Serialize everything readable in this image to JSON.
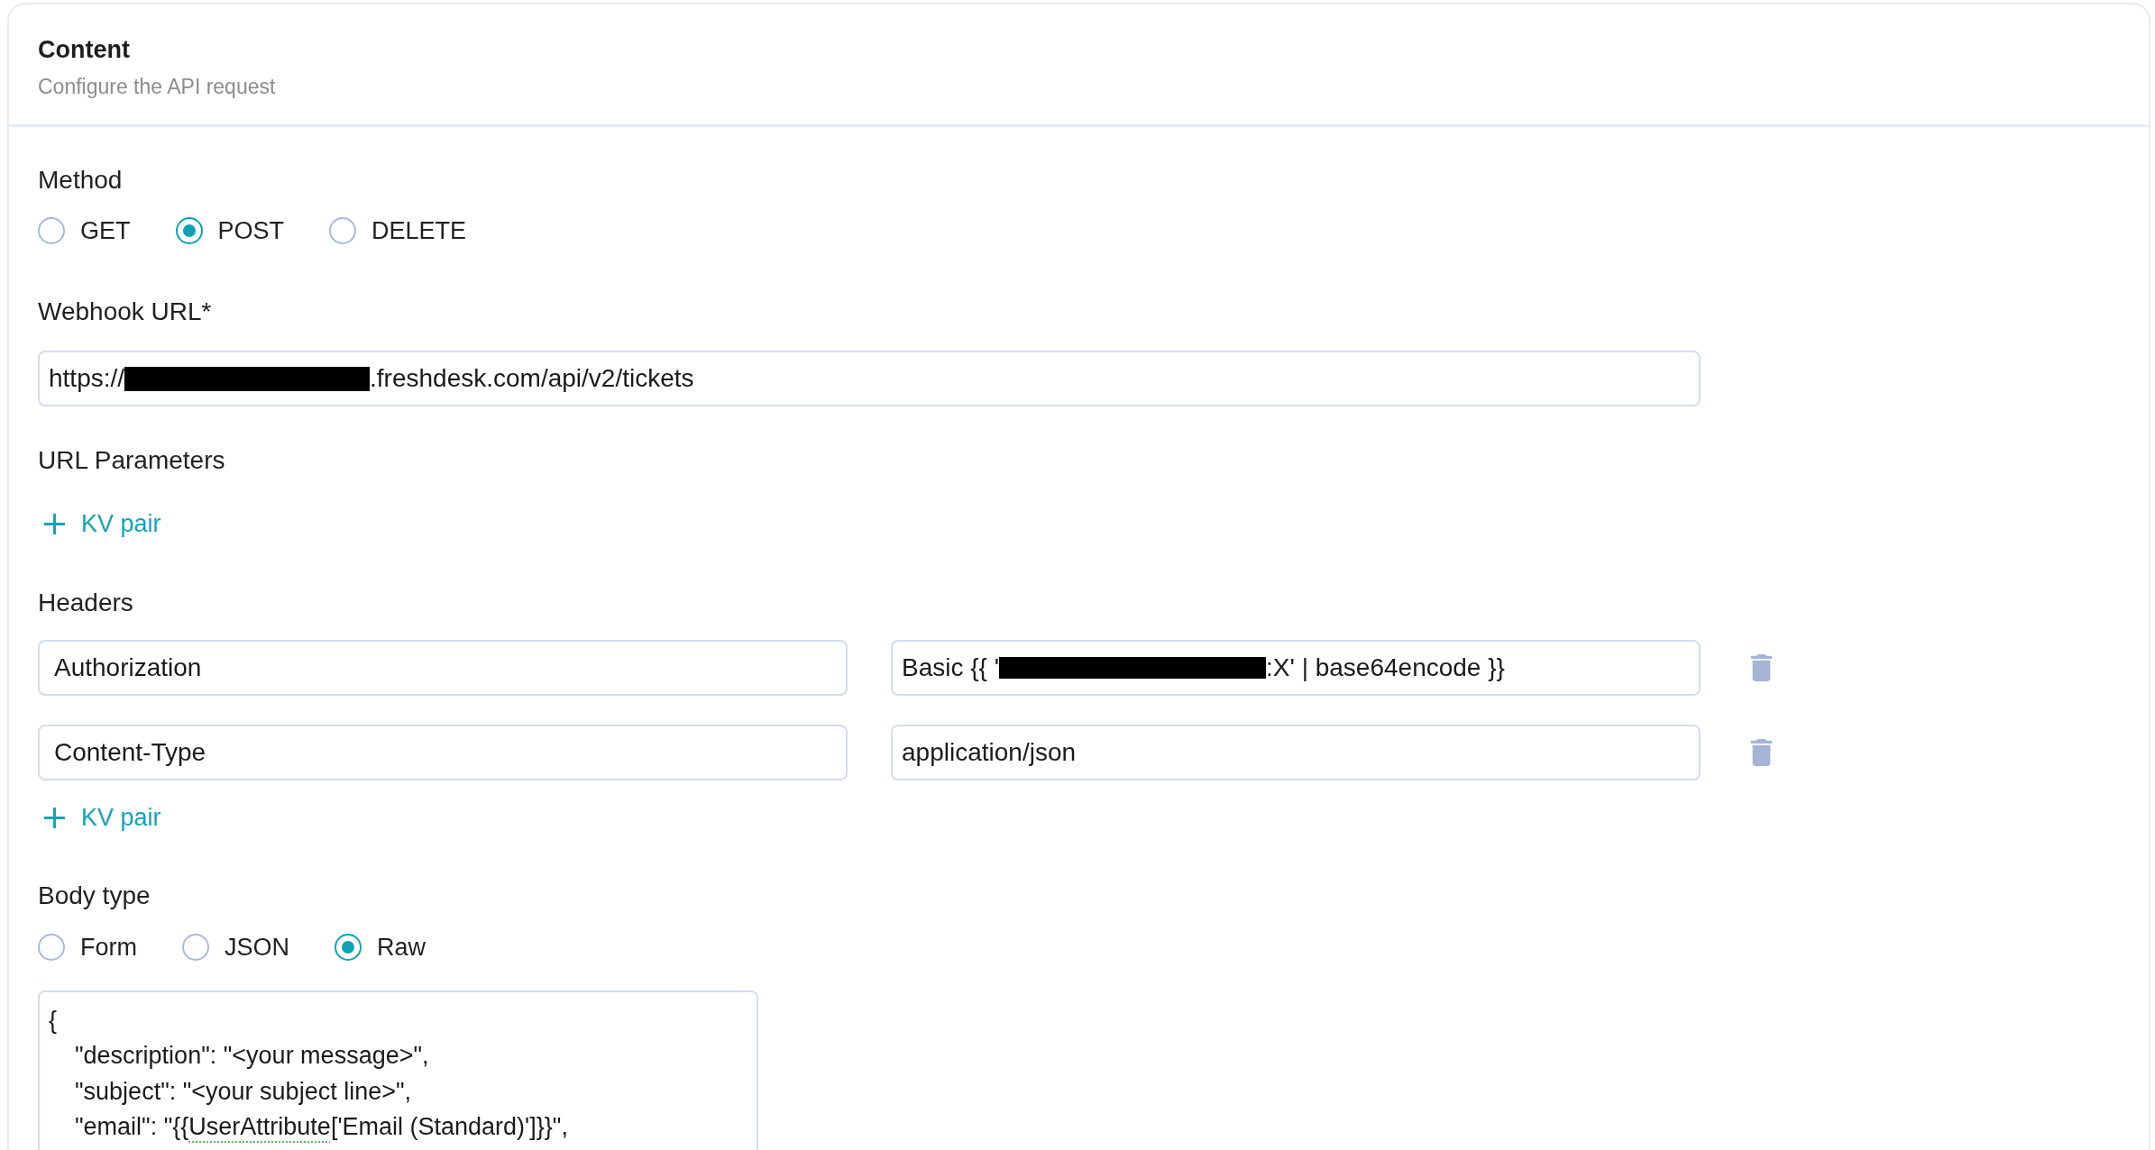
{
  "panel": {
    "title": "Content",
    "subtitle": "Configure the API request"
  },
  "method": {
    "label": "Method",
    "options": [
      {
        "label": "GET",
        "selected": false
      },
      {
        "label": "POST",
        "selected": true
      },
      {
        "label": "DELETE",
        "selected": false
      }
    ]
  },
  "webhook_url": {
    "label": "Webhook URL*",
    "value_parts": [
      {
        "kind": "text",
        "text": "https://"
      },
      {
        "kind": "redaction"
      },
      {
        "kind": "text",
        "text": ".freshdesk.com/api/v2/tickets"
      }
    ]
  },
  "url_parameters": {
    "label": "URL Parameters",
    "add_button": "KV pair"
  },
  "headers": {
    "label": "Headers",
    "rows": [
      {
        "key": "Authorization",
        "value_parts": [
          {
            "kind": "text",
            "text": "Basic {{ '"
          },
          {
            "kind": "redaction"
          },
          {
            "kind": "text",
            "text": ":X' | base64encode }}"
          }
        ]
      },
      {
        "key": "Content-Type",
        "value_parts": [
          {
            "kind": "text",
            "text": "application/json"
          }
        ]
      }
    ],
    "add_button": "KV pair"
  },
  "body_type": {
    "label": "Body type",
    "options": [
      {
        "label": "Form",
        "selected": false
      },
      {
        "label": "JSON",
        "selected": false
      },
      {
        "label": "Raw",
        "selected": true
      }
    ]
  },
  "body": {
    "lines": [
      {
        "parts": [
          {
            "text": "{",
            "flagged": false
          }
        ],
        "children": [
          {
            "parts": [
              {
                "text": "\"description\": \"<your message>\",",
                "flagged": false
              }
            ]
          },
          {
            "parts": [
              {
                "text": "\"subject\": \"<your subject line>\",",
                "flagged": false
              }
            ]
          },
          {
            "parts": [
              {
                "text": "\"email\": \"{{",
                "flagged": false
              },
              {
                "text": "UserAttribute",
                "flagged": true
              },
              {
                "text": "['Email (Standard)']}}\",",
                "flagged": false
              }
            ]
          }
        ]
      }
    ]
  }
}
